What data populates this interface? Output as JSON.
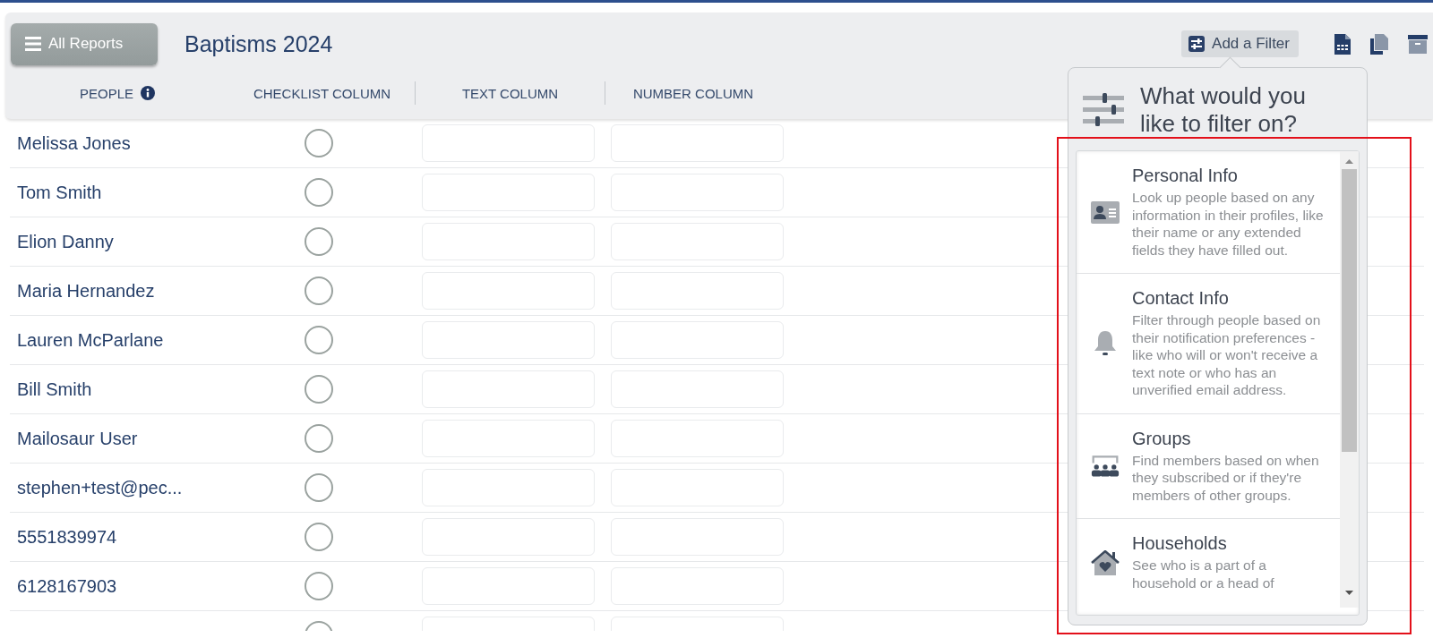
{
  "header": {
    "menu_button": "All Reports",
    "title": "Baptisms 2024",
    "filter_button": "Add a Filter"
  },
  "columns": [
    {
      "label": "PEOPLE",
      "info": true
    },
    {
      "label": "CHECKLIST COLUMN",
      "info": false
    },
    {
      "label": "TEXT COLUMN",
      "info": false
    },
    {
      "label": "NUMBER COLUMN",
      "info": false
    }
  ],
  "rows": [
    {
      "name": "Melissa Jones",
      "checked": false
    },
    {
      "name": "Tom Smith",
      "checked": false
    },
    {
      "name": "Elion Danny",
      "checked": false
    },
    {
      "name": "Maria Hernandez",
      "checked": false
    },
    {
      "name": "Lauren McParlane",
      "checked": false
    },
    {
      "name": "Bill Smith",
      "checked": false
    },
    {
      "name": "Mailosaur User",
      "checked": false
    },
    {
      "name": "stephen+test@pec...",
      "checked": false
    },
    {
      "name": "5551839974",
      "checked": false
    },
    {
      "name": "6128167903",
      "checked": false
    },
    {
      "checked": false
    }
  ],
  "filter_popover": {
    "title": "What would you like to filter on?",
    "options": [
      {
        "kind": "person",
        "title": "Personal Info",
        "description": "Look up people based on any information in their profiles, like their name or any extended fields they have filled out."
      },
      {
        "kind": "contact",
        "title": "Contact Info",
        "description": "Filter through people based on their notification preferences - like who will or won't receive a text note or who has an unverified email address."
      },
      {
        "kind": "groups",
        "title": "Groups",
        "description": "Find members based on when they subscribed or if they're members of other groups."
      },
      {
        "kind": "households",
        "title": "Households",
        "description": "See who is a part of a household or a head of"
      }
    ]
  }
}
